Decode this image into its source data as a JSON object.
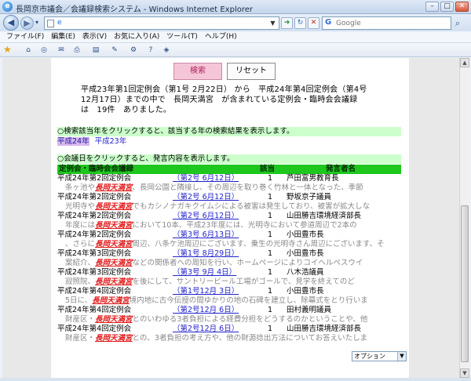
{
  "window": {
    "title": "長岡京市議会／会議録検索システム - Windows Internet Explorer"
  },
  "browser": {
    "address_value": "e",
    "search_placeholder": "Google",
    "menu": [
      "ファイル(F)",
      "編集(E)",
      "表示(V)",
      "お気に入り(A)",
      "ツール(T)",
      "ヘルプ(H)"
    ]
  },
  "toolbar": {
    "search_label": "検索",
    "reset_label": "リセット"
  },
  "summary_text": "平成23年第1回定例会（第1号 2月22日） から　平成24年第4回定例会（第4号12月17日）までの中で　長岡天満宮　が含まれている定例会・臨時会会議録　は　19件　ありました。",
  "year_notice": "○検索該当年をクリックすると、該当する年の検索結果を表示します。",
  "years": [
    "平成24年",
    "平成23年"
  ],
  "speech_notice": "○会議日をクリックすると、発言内容を表示します。",
  "table": {
    "headers": [
      "定例会・臨時会会議録",
      "該当",
      "発言者名"
    ],
    "keyword": "長岡天満宮",
    "rows": [
      {
        "session": "平成24年第2回定例会",
        "ref": "（第2号 6月12日）",
        "count": "1",
        "speaker": "芦田富男教育長",
        "pre": "条ヶ池や",
        "post": "、長岡公園と隣接し、その周辺を取り巻く竹林と一体となった、季節"
      },
      {
        "session": "平成24年第2回定例会",
        "ref": "（第2号 6月12日）",
        "count": "1",
        "speaker": "野坂京子議員",
        "pre": "光明寺や",
        "post": "でもカシノナガキクイムシによる被害は発生しており、被害が拡大しな"
      },
      {
        "session": "平成24年第2回定例会",
        "ref": "（第2号 6月12日）",
        "count": "1",
        "speaker": "山田勝吉環境経済部長",
        "pre": "年度には",
        "post": "において10本、平成23年度には、光明寺において参道周辺で2本の"
      },
      {
        "session": "平成24年第2回定例会",
        "ref": "（第3号 6月13日）",
        "count": "1",
        "speaker": "小田豊市長",
        "pre": "、さらに",
        "post": "周辺、八条ケ池周辺にございます、乗生の光明寺さん周辺にございます、そ"
      },
      {
        "session": "平成24年第3回定例会",
        "ref": "（第1号 8月29日）",
        "count": "1",
        "speaker": "小田豊市長",
        "pre": "案紹介、",
        "post": "などの関係者への周知を行い、ホームページによりコイヘルペスウイ"
      },
      {
        "session": "平成24年第3回定例会",
        "ref": "（第3号 9月 4日）",
        "count": "1",
        "speaker": "八木浩議員",
        "pre": "寂照院、",
        "post": "を後にして、サントリービール工場がゴールで、見学を終えてのど"
      },
      {
        "session": "平成24年第4回定例会",
        "ref": "（第1号12月 3日）",
        "count": "1",
        "speaker": "小田豊市長",
        "pre": "5日に、",
        "post": "境内地に古今伝授の間ゆかりの地の石碑を建立し、除幕式をとり行いま"
      },
      {
        "session": "平成24年第4回定例会",
        "ref": "（第2号12月 6日）",
        "count": "1",
        "speaker": "田村義明議員",
        "pre": "財産区・",
        "post": "とのいわゆる3者負担による経費分担をどうするのかということや、他"
      },
      {
        "session": "平成24年第4回定例会",
        "ref": "（第2号12月 6日）",
        "count": "1",
        "speaker": "山田勝吉環境経済部長",
        "pre": "財産区・",
        "post": "との、3者負担の考え方や、他の財源捻出方法についてお答えいたしま"
      }
    ]
  },
  "option_select": "オプション"
}
